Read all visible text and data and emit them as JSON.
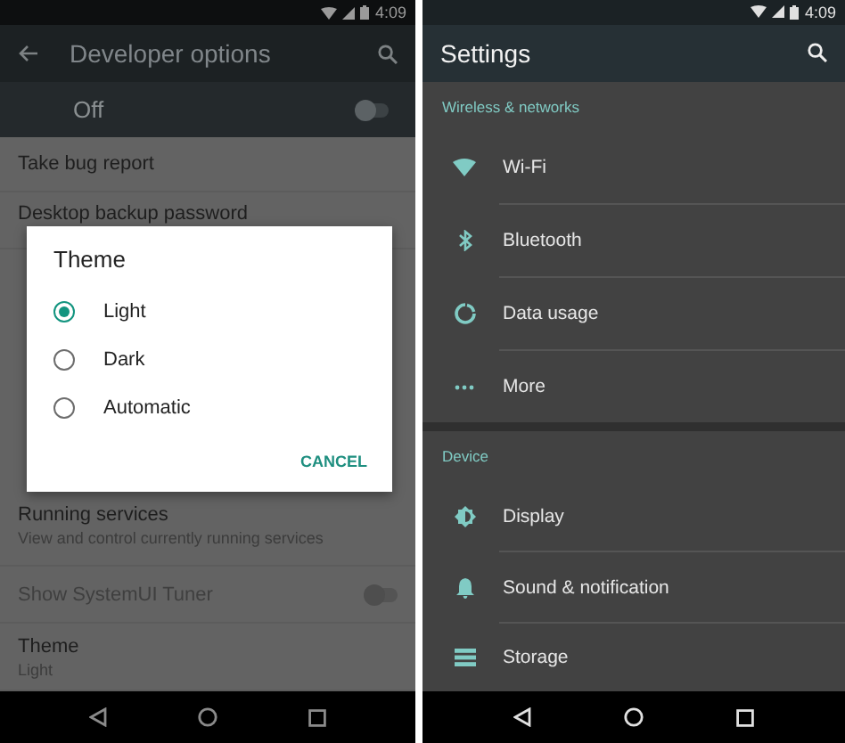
{
  "developer_screen": {
    "status_time": "4:09",
    "title": "Developer options",
    "master_switch": {
      "label": "Off",
      "on": false
    },
    "upper_items": [
      {
        "title": "Take bug report"
      },
      {
        "title": "Desktop backup password"
      }
    ],
    "lower_items": [
      {
        "kind": "text",
        "title": "Running services",
        "subtitle": "View and control currently running services"
      },
      {
        "kind": "toggle",
        "title": "Show SystemUI Tuner",
        "disabled": true,
        "on": false
      },
      {
        "kind": "text",
        "title": "Theme",
        "subtitle": "Light"
      }
    ],
    "dialog": {
      "title": "Theme",
      "options": [
        {
          "label": "Light",
          "selected": true
        },
        {
          "label": "Dark",
          "selected": false
        },
        {
          "label": "Automatic",
          "selected": false
        }
      ],
      "button": "CANCEL"
    }
  },
  "settings_screen": {
    "status_time": "4:09",
    "title": "Settings",
    "sections": [
      {
        "header": "Wireless & networks",
        "items": [
          {
            "kind": "wifi",
            "label": "Wi-Fi"
          },
          {
            "kind": "bluetooth",
            "label": "Bluetooth"
          },
          {
            "kind": "data",
            "label": "Data usage"
          },
          {
            "kind": "more",
            "label": "More"
          }
        ]
      },
      {
        "header": "Device",
        "items": [
          {
            "kind": "display",
            "label": "Display"
          },
          {
            "kind": "bell",
            "label": "Sound & notification"
          },
          {
            "kind": "storage",
            "label": "Storage"
          }
        ]
      }
    ]
  }
}
